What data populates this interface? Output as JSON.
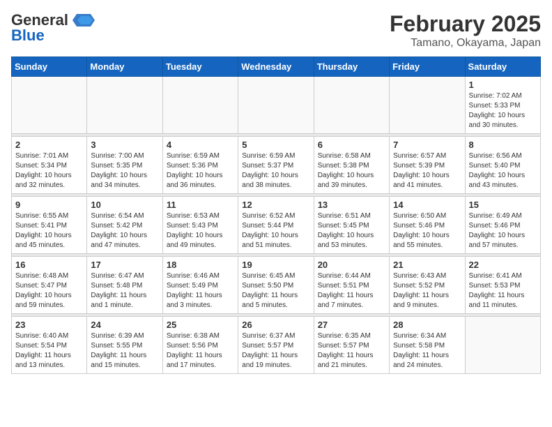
{
  "logo": {
    "text_general": "General",
    "text_blue": "Blue"
  },
  "title": {
    "month_year": "February 2025",
    "location": "Tamano, Okayama, Japan"
  },
  "weekdays": [
    "Sunday",
    "Monday",
    "Tuesday",
    "Wednesday",
    "Thursday",
    "Friday",
    "Saturday"
  ],
  "weeks": [
    [
      {
        "day": "",
        "info": ""
      },
      {
        "day": "",
        "info": ""
      },
      {
        "day": "",
        "info": ""
      },
      {
        "day": "",
        "info": ""
      },
      {
        "day": "",
        "info": ""
      },
      {
        "day": "",
        "info": ""
      },
      {
        "day": "1",
        "info": "Sunrise: 7:02 AM\nSunset: 5:33 PM\nDaylight: 10 hours\nand 30 minutes."
      }
    ],
    [
      {
        "day": "2",
        "info": "Sunrise: 7:01 AM\nSunset: 5:34 PM\nDaylight: 10 hours\nand 32 minutes."
      },
      {
        "day": "3",
        "info": "Sunrise: 7:00 AM\nSunset: 5:35 PM\nDaylight: 10 hours\nand 34 minutes."
      },
      {
        "day": "4",
        "info": "Sunrise: 6:59 AM\nSunset: 5:36 PM\nDaylight: 10 hours\nand 36 minutes."
      },
      {
        "day": "5",
        "info": "Sunrise: 6:59 AM\nSunset: 5:37 PM\nDaylight: 10 hours\nand 38 minutes."
      },
      {
        "day": "6",
        "info": "Sunrise: 6:58 AM\nSunset: 5:38 PM\nDaylight: 10 hours\nand 39 minutes."
      },
      {
        "day": "7",
        "info": "Sunrise: 6:57 AM\nSunset: 5:39 PM\nDaylight: 10 hours\nand 41 minutes."
      },
      {
        "day": "8",
        "info": "Sunrise: 6:56 AM\nSunset: 5:40 PM\nDaylight: 10 hours\nand 43 minutes."
      }
    ],
    [
      {
        "day": "9",
        "info": "Sunrise: 6:55 AM\nSunset: 5:41 PM\nDaylight: 10 hours\nand 45 minutes."
      },
      {
        "day": "10",
        "info": "Sunrise: 6:54 AM\nSunset: 5:42 PM\nDaylight: 10 hours\nand 47 minutes."
      },
      {
        "day": "11",
        "info": "Sunrise: 6:53 AM\nSunset: 5:43 PM\nDaylight: 10 hours\nand 49 minutes."
      },
      {
        "day": "12",
        "info": "Sunrise: 6:52 AM\nSunset: 5:44 PM\nDaylight: 10 hours\nand 51 minutes."
      },
      {
        "day": "13",
        "info": "Sunrise: 6:51 AM\nSunset: 5:45 PM\nDaylight: 10 hours\nand 53 minutes."
      },
      {
        "day": "14",
        "info": "Sunrise: 6:50 AM\nSunset: 5:46 PM\nDaylight: 10 hours\nand 55 minutes."
      },
      {
        "day": "15",
        "info": "Sunrise: 6:49 AM\nSunset: 5:46 PM\nDaylight: 10 hours\nand 57 minutes."
      }
    ],
    [
      {
        "day": "16",
        "info": "Sunrise: 6:48 AM\nSunset: 5:47 PM\nDaylight: 10 hours\nand 59 minutes."
      },
      {
        "day": "17",
        "info": "Sunrise: 6:47 AM\nSunset: 5:48 PM\nDaylight: 11 hours\nand 1 minute."
      },
      {
        "day": "18",
        "info": "Sunrise: 6:46 AM\nSunset: 5:49 PM\nDaylight: 11 hours\nand 3 minutes."
      },
      {
        "day": "19",
        "info": "Sunrise: 6:45 AM\nSunset: 5:50 PM\nDaylight: 11 hours\nand 5 minutes."
      },
      {
        "day": "20",
        "info": "Sunrise: 6:44 AM\nSunset: 5:51 PM\nDaylight: 11 hours\nand 7 minutes."
      },
      {
        "day": "21",
        "info": "Sunrise: 6:43 AM\nSunset: 5:52 PM\nDaylight: 11 hours\nand 9 minutes."
      },
      {
        "day": "22",
        "info": "Sunrise: 6:41 AM\nSunset: 5:53 PM\nDaylight: 11 hours\nand 11 minutes."
      }
    ],
    [
      {
        "day": "23",
        "info": "Sunrise: 6:40 AM\nSunset: 5:54 PM\nDaylight: 11 hours\nand 13 minutes."
      },
      {
        "day": "24",
        "info": "Sunrise: 6:39 AM\nSunset: 5:55 PM\nDaylight: 11 hours\nand 15 minutes."
      },
      {
        "day": "25",
        "info": "Sunrise: 6:38 AM\nSunset: 5:56 PM\nDaylight: 11 hours\nand 17 minutes."
      },
      {
        "day": "26",
        "info": "Sunrise: 6:37 AM\nSunset: 5:57 PM\nDaylight: 11 hours\nand 19 minutes."
      },
      {
        "day": "27",
        "info": "Sunrise: 6:35 AM\nSunset: 5:57 PM\nDaylight: 11 hours\nand 21 minutes."
      },
      {
        "day": "28",
        "info": "Sunrise: 6:34 AM\nSunset: 5:58 PM\nDaylight: 11 hours\nand 24 minutes."
      },
      {
        "day": "",
        "info": ""
      }
    ]
  ]
}
